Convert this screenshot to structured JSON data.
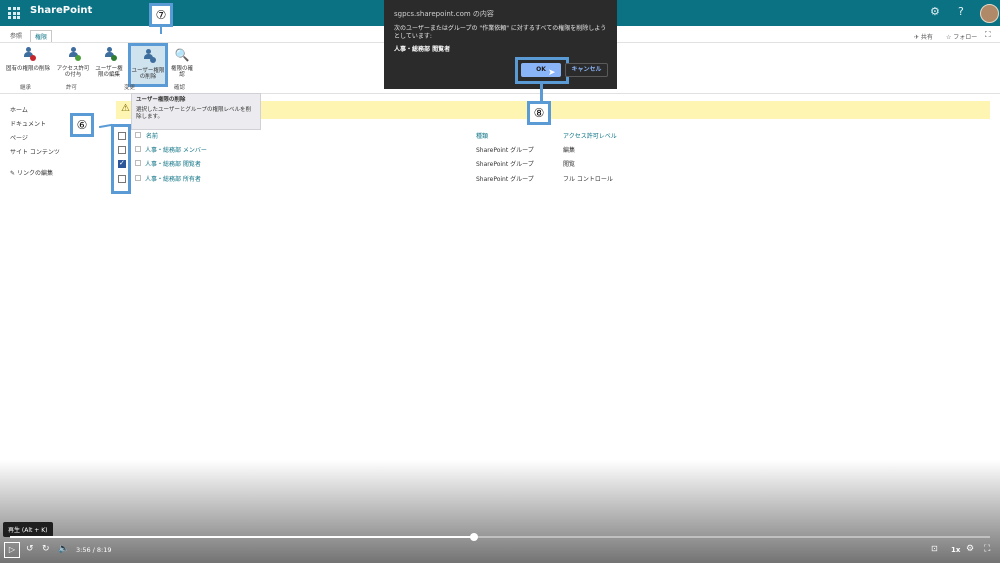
{
  "suitebar": {
    "brand": "SharePoint",
    "gear_icon": "gear-icon",
    "help_icon": "help-icon"
  },
  "ribbon": {
    "tabs": [
      {
        "label": "参照"
      },
      {
        "label": "権限"
      }
    ],
    "share": "✈ 共有",
    "follow": "☆ フォロー",
    "buttons": [
      {
        "label": "固有の権限の削除"
      },
      {
        "label": "アクセス許可の付与"
      },
      {
        "label": "ユーザー権限の編集"
      },
      {
        "label": "ユーザー権限の削除"
      },
      {
        "label": "権限の確認"
      }
    ],
    "groups": [
      "継承",
      "許可",
      "変更",
      "確認"
    ]
  },
  "nav": {
    "items": [
      "ホーム",
      "ドキュメント",
      "ページ",
      "サイト コンテンツ"
    ],
    "edit_links": "リンクの編集"
  },
  "tooltip": {
    "title": "ユーザー権限の削除",
    "body": "選択したユーザーとグループの権限レベルを削除します。"
  },
  "table": {
    "headers": {
      "name": "名前",
      "type": "種類",
      "level": "アクセス許可レベル"
    },
    "rows": [
      {
        "name": "人事・総務部 メンバー",
        "type": "SharePoint グループ",
        "level": "編集",
        "checked": false
      },
      {
        "name": "人事・総務部 閲覧者",
        "type": "SharePoint グループ",
        "level": "閲覧",
        "checked": true
      },
      {
        "name": "人事・総務部 所有者",
        "type": "SharePoint グループ",
        "level": "フル コントロール",
        "checked": false
      }
    ]
  },
  "dialog": {
    "title": "sgpcs.sharepoint.com の内容",
    "message": "次のユーザーまたはグループの \"作業依頼\" に対するすべての権限を削除しようとしています:",
    "user": "人事・総務部 閲覧者",
    "ok": "OK",
    "cancel": "キャンセル"
  },
  "callouts": {
    "six": "⑥",
    "seven": "⑦",
    "eight": "⑧"
  },
  "player": {
    "tooltip": "再生 (Alt + K)",
    "time": "3:56 / 8:19",
    "speed": "1x",
    "progress": 0.473
  }
}
